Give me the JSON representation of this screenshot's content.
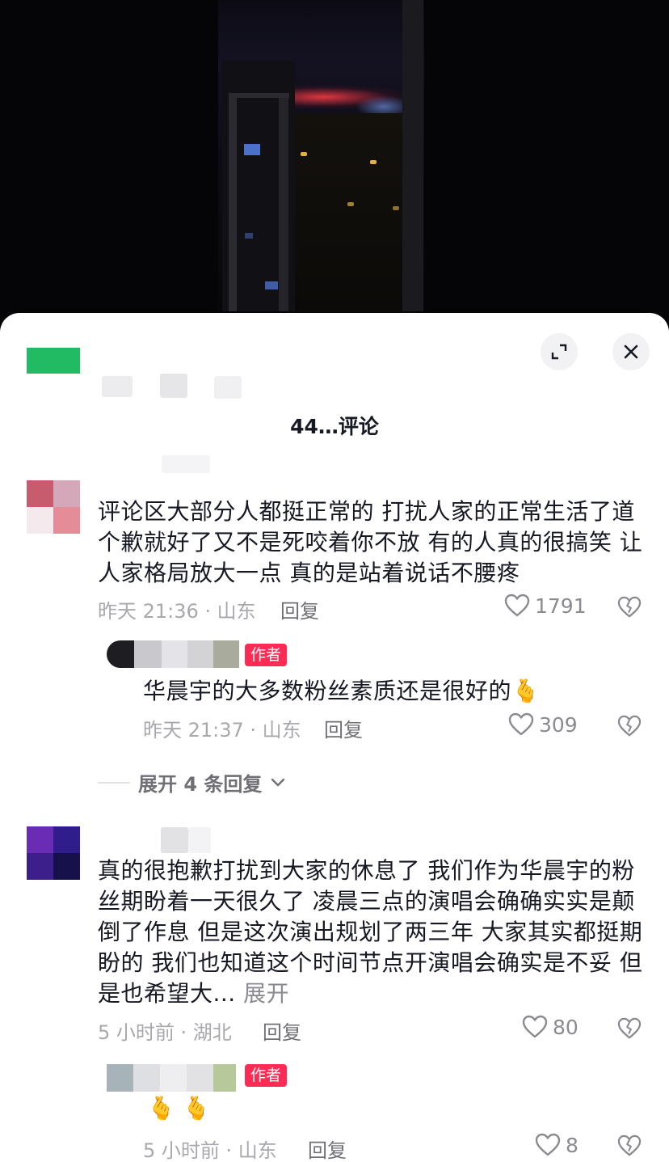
{
  "header": {
    "title": "44…评论",
    "expand_label": "展开",
    "close_label": "关闭"
  },
  "comments": [
    {
      "text": "评论区大部分人都挺正常的 打扰人家的正常生活了道个歉就好了又不是死咬着你不放 有的人真的很搞笑 让人家格局放大一点 真的是站着说话不腰疼",
      "time": "昨天 21:36 · 山东",
      "reply_label": "回复",
      "likes": "1791",
      "reply": {
        "badge": "作者",
        "text": "华晨宇的大多数粉丝素质还是很好的",
        "emoji": "🫰",
        "time": "昨天 21:37 · 山东",
        "reply_label": "回复",
        "likes": "309"
      },
      "expand_replies": "展开 4 条回复"
    },
    {
      "text": "真的很抱歉打扰到大家的休息了 我们作为华晨宇的粉丝期盼着一天很久了 凌晨三点的演唱会确确实实是颠倒了作息 但是这次演出规划了两三年 大家其实都挺期盼的 我们也知道这个时间节点开演唱会确实是不妥 但是也希望大...",
      "more": "展开",
      "time": "5 小时前 · 湖北",
      "reply_label": "回复",
      "likes": "80",
      "reply": {
        "badge": "作者",
        "emoji": "🫰 🫰",
        "time": "5 小时前 · 山东",
        "reply_label": "回复",
        "likes": "8"
      }
    }
  ],
  "colors": {
    "badge": "#fe2c55",
    "text": "#161823",
    "meta": "#a8a8ad",
    "brand_green": "#20bb62"
  },
  "icons": [
    "expand-icon",
    "close-icon",
    "heart-icon",
    "broken-heart-icon",
    "chevron-down-icon"
  ]
}
